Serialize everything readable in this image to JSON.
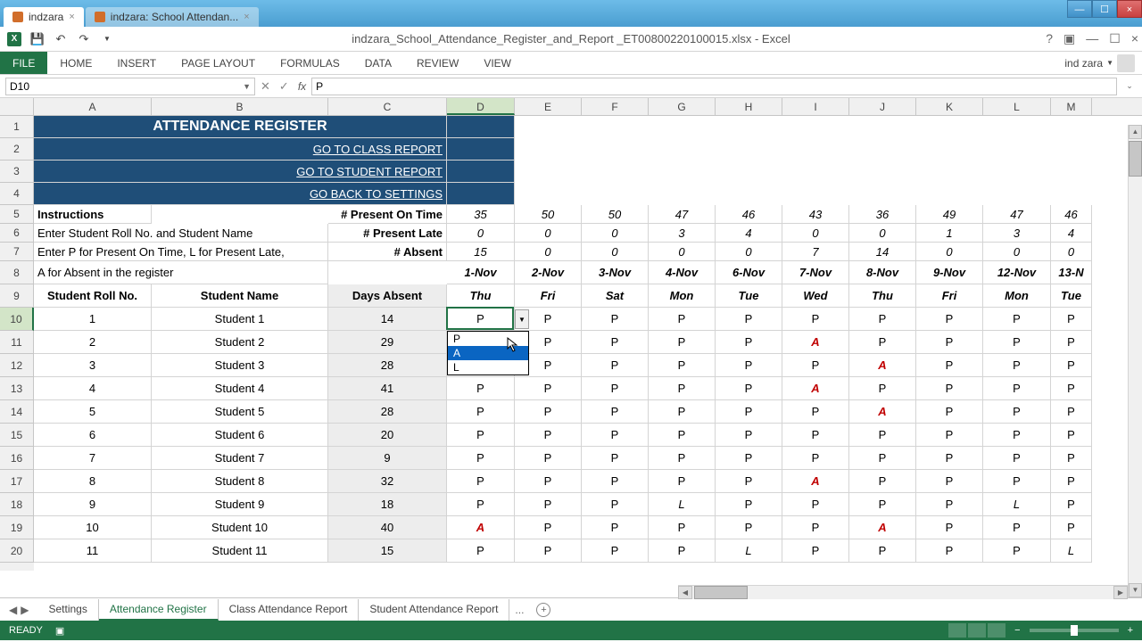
{
  "browser": {
    "tabs": [
      {
        "title": "indzara"
      },
      {
        "title": "indzara: School Attendan..."
      }
    ]
  },
  "excel": {
    "title": "indzara_School_Attendance_Register_and_Report _ET00800220100015.xlsx - Excel",
    "username": "ind zara",
    "ribbon_tabs": [
      "FILE",
      "HOME",
      "INSERT",
      "PAGE LAYOUT",
      "FORMULAS",
      "DATA",
      "REVIEW",
      "VIEW"
    ],
    "name_box": "D10",
    "formula_value": "P",
    "status": "READY"
  },
  "columns": [
    "A",
    "B",
    "C",
    "D",
    "E",
    "F",
    "G",
    "H",
    "I",
    "J",
    "K",
    "L",
    "M"
  ],
  "col_widths": {
    "A": 132,
    "B": 198,
    "C": 133,
    "D": 76,
    "E": 75,
    "F": 75,
    "G": 75,
    "H": 75,
    "I": 75,
    "J": 75,
    "K": 75,
    "L": 76,
    "M": 46
  },
  "rows": [
    1,
    2,
    3,
    4,
    5,
    6,
    7,
    8,
    9,
    10,
    11,
    12,
    13,
    14,
    15,
    16,
    17,
    18,
    19,
    20
  ],
  "row_heights": {
    "1": 25,
    "2": 25,
    "3": 25,
    "4": 25,
    "5": 21,
    "6": 21,
    "7": 21,
    "8": 26,
    "9": 26,
    "10": 26,
    "11": 26,
    "12": 26,
    "13": 26,
    "14": 26,
    "15": 26,
    "16": 26,
    "17": 26,
    "18": 26,
    "19": 26,
    "20": 26
  },
  "sheet": {
    "title": "ATTENDANCE REGISTER",
    "links": [
      "GO TO CLASS REPORT",
      "GO TO STUDENT REPORT",
      "GO BACK TO SETTINGS"
    ],
    "instructions_label": "Instructions",
    "instructions": [
      "Enter Student Roll No. and Student Name",
      "Enter P for Present On Time, L for Present Late,",
      "A for Absent in the register"
    ],
    "summary_labels": [
      "# Present On Time",
      "# Present Late",
      "# Absent"
    ],
    "summary": {
      "present_on_time": [
        35,
        50,
        50,
        47,
        46,
        43,
        36,
        49,
        47,
        46
      ],
      "present_late": [
        0,
        0,
        0,
        3,
        4,
        0,
        0,
        1,
        3,
        4
      ],
      "absent": [
        15,
        0,
        0,
        0,
        0,
        7,
        14,
        0,
        0,
        0
      ]
    },
    "dates": [
      "1-Nov",
      "2-Nov",
      "3-Nov",
      "4-Nov",
      "6-Nov",
      "7-Nov",
      "8-Nov",
      "9-Nov",
      "12-Nov",
      "13-N"
    ],
    "daynames": [
      "Thu",
      "Fri",
      "Sat",
      "Mon",
      "Tue",
      "Wed",
      "Thu",
      "Fri",
      "Mon",
      "Tue"
    ],
    "table_headers": [
      "Student Roll No.",
      "Student Name",
      "Days Absent"
    ],
    "students": [
      {
        "roll": 1,
        "name": "Student 1",
        "absent": 14,
        "att": [
          "P",
          "P",
          "P",
          "P",
          "P",
          "P",
          "P",
          "P",
          "P",
          "P"
        ]
      },
      {
        "roll": 2,
        "name": "Student 2",
        "absent": 29,
        "att": [
          "",
          "P",
          "P",
          "P",
          "P",
          "A",
          "P",
          "P",
          "P",
          "P"
        ]
      },
      {
        "roll": 3,
        "name": "Student 3",
        "absent": 28,
        "att": [
          "",
          "P",
          "P",
          "P",
          "P",
          "P",
          "A",
          "P",
          "P",
          "P"
        ]
      },
      {
        "roll": 4,
        "name": "Student 4",
        "absent": 41,
        "att": [
          "P",
          "P",
          "P",
          "P",
          "P",
          "A",
          "P",
          "P",
          "P",
          "P"
        ]
      },
      {
        "roll": 5,
        "name": "Student 5",
        "absent": 28,
        "att": [
          "P",
          "P",
          "P",
          "P",
          "P",
          "P",
          "A",
          "P",
          "P",
          "P"
        ]
      },
      {
        "roll": 6,
        "name": "Student 6",
        "absent": 20,
        "att": [
          "P",
          "P",
          "P",
          "P",
          "P",
          "P",
          "P",
          "P",
          "P",
          "P"
        ]
      },
      {
        "roll": 7,
        "name": "Student 7",
        "absent": 9,
        "att": [
          "P",
          "P",
          "P",
          "P",
          "P",
          "P",
          "P",
          "P",
          "P",
          "P"
        ]
      },
      {
        "roll": 8,
        "name": "Student 8",
        "absent": 32,
        "att": [
          "P",
          "P",
          "P",
          "P",
          "P",
          "A",
          "P",
          "P",
          "P",
          "P"
        ]
      },
      {
        "roll": 9,
        "name": "Student 9",
        "absent": 18,
        "att": [
          "P",
          "P",
          "P",
          "L",
          "P",
          "P",
          "P",
          "P",
          "L",
          "P"
        ]
      },
      {
        "roll": 10,
        "name": "Student 10",
        "absent": 40,
        "att": [
          "A",
          "P",
          "P",
          "P",
          "P",
          "P",
          "A",
          "P",
          "P",
          "P"
        ]
      },
      {
        "roll": 11,
        "name": "Student 11",
        "absent": 15,
        "att": [
          "P",
          "P",
          "P",
          "P",
          "L",
          "P",
          "P",
          "P",
          "P",
          "L"
        ]
      }
    ],
    "dropdown_options": [
      "P",
      "A",
      "L"
    ],
    "active_cell": "D10"
  },
  "sheet_tabs": [
    "Settings",
    "Attendance Register",
    "Class Attendance Report",
    "Student Attendance Report"
  ],
  "sheet_tabs_active": 1,
  "sheet_tabs_ellipsis": "..."
}
